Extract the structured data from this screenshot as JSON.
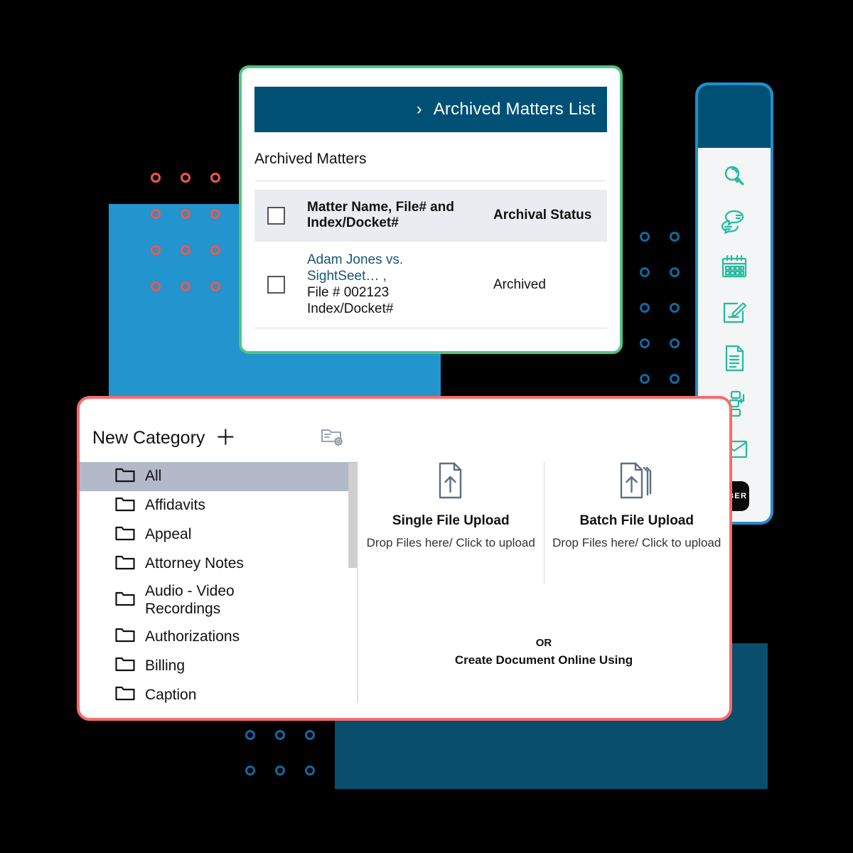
{
  "colors": {
    "header_blue": "#005075",
    "accent_blue": "#2294CE",
    "navy": "#0A4E6E",
    "green_border": "#4FC584",
    "red_border": "#FB6B6B",
    "toolbar_border": "#1F8FCD",
    "teal_icon": "#22BC9C",
    "link": "#1A5578",
    "dot_red": "#F4554C",
    "dot_blue": "#1368A0",
    "selected_row": "#B4B9C9",
    "table_head": "#E9EDF1"
  },
  "matters_card": {
    "header": {
      "chevron": "›",
      "title": "Archived Matters List"
    },
    "section_title": "Archived Matters",
    "table": {
      "columns": [
        "",
        "Matter Name, File# and Index/Docket#",
        "Archival Status"
      ],
      "rows": [
        {
          "checked": false,
          "matter_link": "Adam Jones vs. SightSeet… ,",
          "file_number": "File # 002123",
          "index_docket": "Index/Docket#",
          "status": "Archived"
        }
      ]
    }
  },
  "toolbar": {
    "items": [
      {
        "icon": "search-icon"
      },
      {
        "icon": "chat-bubbles-icon"
      },
      {
        "icon": "calendar-icon"
      },
      {
        "icon": "edit-note-icon"
      },
      {
        "icon": "document-icon"
      },
      {
        "icon": "workflow-icon"
      },
      {
        "icon": "envelope-icon"
      }
    ],
    "uber_label": "UBER"
  },
  "docs_card": {
    "category_header": {
      "title": "New Category",
      "add_symbol": "＋",
      "settings_icon": "folder-settings-icon"
    },
    "categories": [
      {
        "label": "All",
        "selected": true
      },
      {
        "label": "Affidavits",
        "selected": false
      },
      {
        "label": "Appeal",
        "selected": false
      },
      {
        "label": "Attorney Notes",
        "selected": false
      },
      {
        "label": "Audio - Video Recordings",
        "selected": false
      },
      {
        "label": "Authorizations",
        "selected": false
      },
      {
        "label": "Billing",
        "selected": false
      },
      {
        "label": "Caption",
        "selected": false
      }
    ],
    "upload": {
      "single": {
        "title": "Single File Upload",
        "subtitle": "Drop Files here/ Click to upload",
        "icon": "single-file-upload-icon"
      },
      "batch": {
        "title": "Batch File Upload",
        "subtitle": "Drop Files here/ Click to upload",
        "icon": "batch-file-upload-icon"
      },
      "or_text": "OR",
      "create_text": "Create Document Online Using"
    }
  }
}
